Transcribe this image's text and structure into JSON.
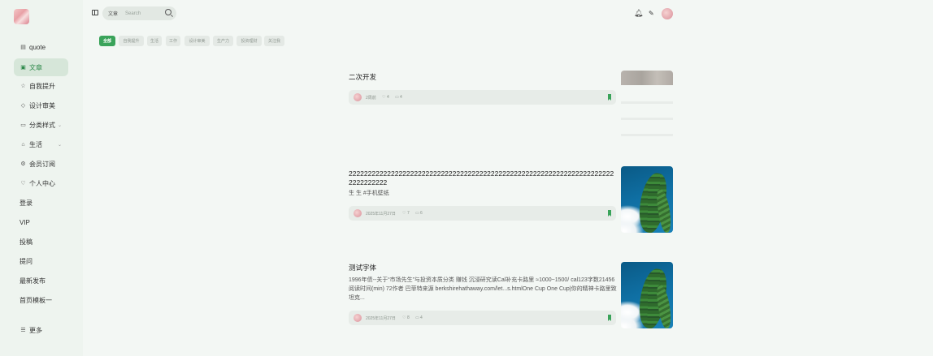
{
  "sidebar": {
    "items": [
      {
        "label": "quote",
        "icon": "document-icon"
      },
      {
        "label": "文章",
        "icon": "article-icon",
        "active": true
      },
      {
        "label": "自我提升",
        "icon": "star-icon"
      },
      {
        "label": "设计审美",
        "icon": "diamond-icon"
      },
      {
        "label": "分类样式",
        "icon": "monitor-icon",
        "expandable": true
      },
      {
        "label": "生活",
        "icon": "home-icon",
        "expandable": true
      },
      {
        "label": "会员订阅",
        "icon": "gear-icon"
      },
      {
        "label": "个人中心",
        "icon": "heart-icon"
      },
      {
        "label": "登录"
      },
      {
        "label": "VIP"
      },
      {
        "label": "投稿"
      },
      {
        "label": "提问"
      },
      {
        "label": "最新发布"
      },
      {
        "label": "首页模板一"
      }
    ],
    "more_label": "更多"
  },
  "search": {
    "scope": "文章",
    "placeholder": "Search"
  },
  "chips": [
    "全部",
    "自我提升",
    "生活",
    "工作",
    "设计审美",
    "生产力",
    "投资理财",
    "关注我"
  ],
  "articles": [
    {
      "title": "二次开发",
      "excerpt": "",
      "date": "2周前",
      "likes": "4",
      "comments": "4"
    },
    {
      "title": "2222222222222222222222222222222222222222222222222222222222222222222222222222222",
      "excerpt": "生 生 #手机壁纸",
      "date": "2025年11月27日",
      "likes": "7",
      "comments": "6"
    },
    {
      "title": "测试字体",
      "excerpt": "1996年债--关于“市场先生”与投资本质分类 赚钱 沉浸研究读Cal补充卡路里 ≈1000~1500/ cal123字数21456阅读时间(min) 72作者 巴菲特来源 berkshirehathaway.com/let...s.htmlOne Cup One Cup|你的精神卡路里致坦克...",
      "date": "2025年11月27日",
      "likes": "8",
      "comments": "4"
    }
  ],
  "colors": {
    "accent": "#3aa35a",
    "background": "#f3f7f4",
    "sidebar": "#eef4ef"
  }
}
